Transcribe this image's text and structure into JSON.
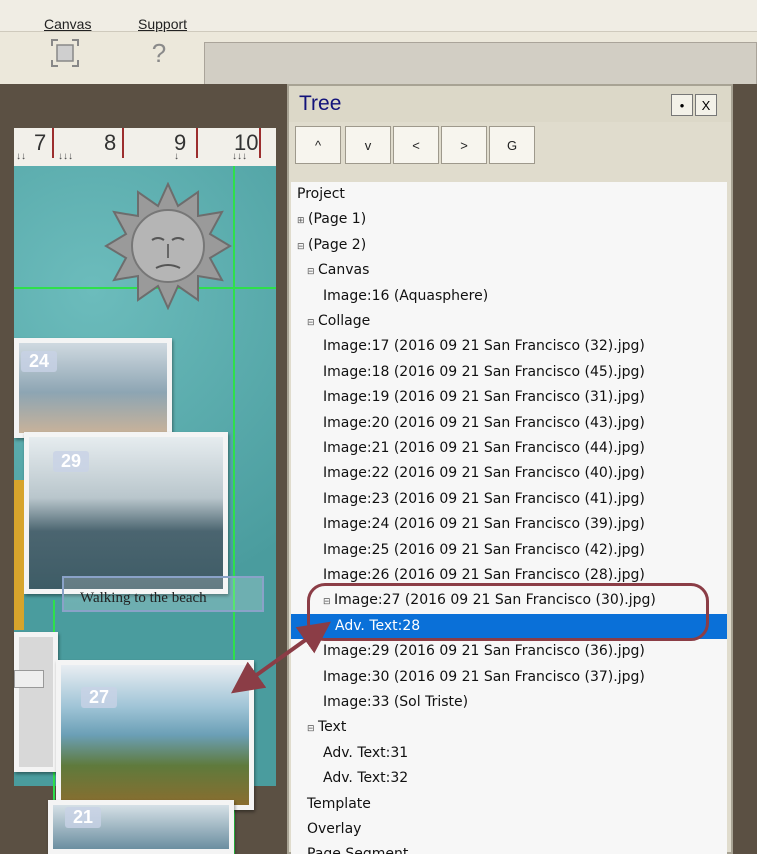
{
  "menu": {
    "items": [
      "Canvas",
      "Support"
    ]
  },
  "toolbar": {
    "fit_icon": "fit-to-page-icon",
    "help_glyph": "?"
  },
  "ruler": {
    "numbers": [
      "7",
      "8",
      "9",
      "10"
    ]
  },
  "canvas": {
    "photo_labels": [
      "24",
      "29",
      "27",
      "21"
    ],
    "text_overlay": "Walking to the beach",
    "colors": {
      "background": "#4fa4a6",
      "guides": "#2ee04a",
      "selection": "#8aa2c8"
    }
  },
  "tree": {
    "title": "Tree",
    "pin_glyph": "•",
    "close_glyph": "X",
    "nav_buttons": [
      "^",
      "v",
      "<",
      ">",
      "G"
    ],
    "rows": [
      {
        "label": "Project",
        "expander": "",
        "indent": 0
      },
      {
        "label": "(Page 1)",
        "expander": "⊞",
        "indent": 0
      },
      {
        "label": "(Page 2)",
        "expander": "⊟",
        "indent": 0
      },
      {
        "label": "Canvas",
        "expander": "⊟",
        "indent": 1
      },
      {
        "label": "Image:16 (Aquasphere)",
        "expander": "",
        "indent": 2
      },
      {
        "label": "Collage",
        "expander": "⊟",
        "indent": 1
      },
      {
        "label": "Image:17 (2016 09 21 San Francisco (32).jpg)",
        "expander": "",
        "indent": 2
      },
      {
        "label": "Image:18 (2016 09 21 San Francisco (45).jpg)",
        "expander": "",
        "indent": 2
      },
      {
        "label": "Image:19 (2016 09 21 San Francisco (31).jpg)",
        "expander": "",
        "indent": 2
      },
      {
        "label": "Image:20 (2016 09 21 San Francisco (43).jpg)",
        "expander": "",
        "indent": 2
      },
      {
        "label": "Image:21 (2016 09 21 San Francisco (44).jpg)",
        "expander": "",
        "indent": 2
      },
      {
        "label": "Image:22 (2016 09 21 San Francisco (40).jpg)",
        "expander": "",
        "indent": 2
      },
      {
        "label": "Image:23 (2016 09 21 San Francisco (41).jpg)",
        "expander": "",
        "indent": 2
      },
      {
        "label": "Image:24 (2016 09 21 San Francisco (39).jpg)",
        "expander": "",
        "indent": 2
      },
      {
        "label": "Image:25 (2016 09 21 San Francisco (42).jpg)",
        "expander": "",
        "indent": 2
      },
      {
        "label": "Image:26 (2016 09 21 San Francisco (28).jpg)",
        "expander": "",
        "indent": 2
      },
      {
        "label": "Image:27 (2016 09 21 San Francisco (30).jpg)",
        "expander": "⊟",
        "indent": 2
      },
      {
        "label": "Adv. Text:28",
        "expander": "",
        "indent": 3,
        "selected": true
      },
      {
        "label": "Image:29 (2016 09 21 San Francisco (36).jpg)",
        "expander": "",
        "indent": 2
      },
      {
        "label": "Image:30 (2016 09 21 San Francisco (37).jpg)",
        "expander": "",
        "indent": 2
      },
      {
        "label": "Image:33 (Sol Triste)",
        "expander": "",
        "indent": 2
      },
      {
        "label": "Text",
        "expander": "⊟",
        "indent": 1
      },
      {
        "label": "Adv. Text:31",
        "expander": "",
        "indent": 2
      },
      {
        "label": "Adv. Text:32",
        "expander": "",
        "indent": 2
      },
      {
        "label": "Template",
        "expander": "",
        "indent": 1
      },
      {
        "label": "Overlay",
        "expander": "",
        "indent": 1
      },
      {
        "label": "Page Segment",
        "expander": "",
        "indent": 1
      }
    ],
    "colors": {
      "selected_row": "#0a70d8",
      "title": "#12127a",
      "callout": "#8b3d46"
    }
  }
}
